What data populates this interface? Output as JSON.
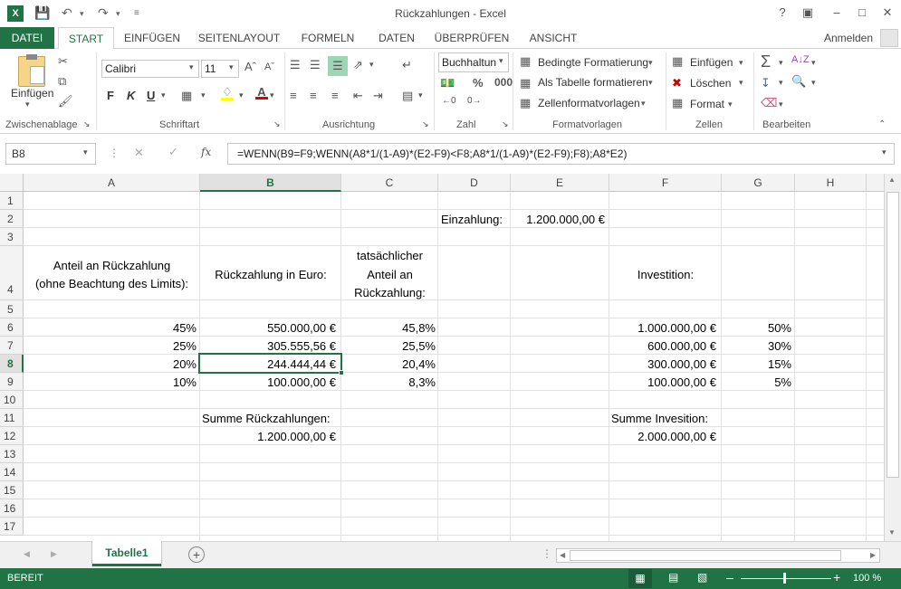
{
  "window": {
    "title": "Rückzahlungen - Excel",
    "help": "?",
    "account": "Anmelden"
  },
  "tabs": [
    "DATEI",
    "START",
    "EINFÜGEN",
    "SEITENLAYOUT",
    "FORMELN",
    "DATEN",
    "ÜBERPRÜFEN",
    "ANSICHT"
  ],
  "ribbon": {
    "clipboard": {
      "paste": "Einfügen",
      "label": "Zwischenablage"
    },
    "font": {
      "name": "Calibri",
      "size": "11",
      "bold": "F",
      "italic": "K",
      "underline": "U",
      "label": "Schriftart"
    },
    "alignment": {
      "label": "Ausrichtung"
    },
    "number": {
      "format": "Buchhaltun",
      "label": "Zahl"
    },
    "styles": {
      "conditional": "Bedingte Formatierung",
      "as_table": "Als Tabelle formatieren",
      "cell_styles": "Zellenformatvorlagen",
      "label": "Formatvorlagen"
    },
    "cells": {
      "insert": "Einfügen",
      "delete": "Löschen",
      "format": "Format",
      "label": "Zellen"
    },
    "editing": {
      "label": "Bearbeiten"
    }
  },
  "formula_bar": {
    "name_box": "B8",
    "fx": "fx",
    "formula": "=WENN(B9=F9;WENN(A8*1/(1-A9)*(E2-F9)<F8;A8*1/(1-A9)*(E2-F9);F8);A8*E2)"
  },
  "grid": {
    "columns": [
      "A",
      "B",
      "C",
      "D",
      "E",
      "F",
      "G",
      "H"
    ],
    "rows": [
      "1",
      "2",
      "3",
      "4",
      "5",
      "6",
      "7",
      "8",
      "9",
      "10",
      "11",
      "12",
      "13",
      "14",
      "15",
      "16",
      "17"
    ],
    "selected_col": "B",
    "selected_row": "8",
    "cells": {
      "D2": "Einzahlung:",
      "E2": "1.200.000,00 €",
      "A4a": "Anteil an Rückzahlung",
      "A4b": "(ohne Beachtung des Limits):",
      "B4": "Rückzahlung in Euro:",
      "C4a": "tatsächlicher",
      "C4b": "Anteil an",
      "C4c": "Rückzahlung:",
      "F4": "Investition:",
      "A6": "45%",
      "B6": "550.000,00 €",
      "C6": "45,8%",
      "F6": "1.000.000,00 €",
      "G6": "50%",
      "A7": "25%",
      "B7": "305.555,56 €",
      "C7": "25,5%",
      "F7": "600.000,00 €",
      "G7": "30%",
      "A8": "20%",
      "B8": "244.444,44 €",
      "C8": "20,4%",
      "F8": "300.000,00 €",
      "G8": "15%",
      "A9": "10%",
      "B9": "100.000,00 €",
      "C9": "8,3%",
      "F9": "100.000,00 €",
      "G9": "5%",
      "B11": "Summe Rückzahlungen:",
      "F11": "Summe Invesition:",
      "B12": "1.200.000,00 €",
      "F12": "2.000.000,00 €"
    }
  },
  "sheet": {
    "tab": "Tabelle1"
  },
  "status": {
    "mode": "BEREIT",
    "zoom": "100 %"
  },
  "colors": {
    "accent": "#217346"
  }
}
